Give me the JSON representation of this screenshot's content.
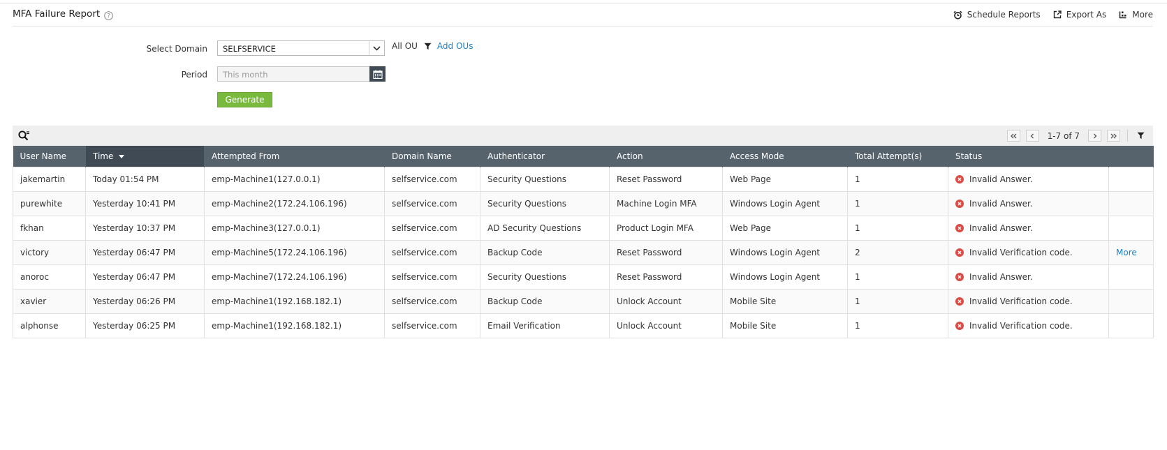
{
  "header": {
    "title": "MFA Failure Report",
    "actions": [
      {
        "label": "Schedule Reports",
        "icon": "alarm-clock-icon"
      },
      {
        "label": "Export As",
        "icon": "export-icon"
      },
      {
        "label": "More",
        "icon": "more-icon"
      }
    ]
  },
  "form": {
    "domain_label": "Select Domain",
    "domain_value": "SELFSERVICE",
    "ou_label": "All OU",
    "add_ous_label": "Add OUs",
    "period_label": "Period",
    "period_placeholder": "This month",
    "generate_label": "Generate"
  },
  "pager": {
    "range_text": "1-7 of 7"
  },
  "table": {
    "columns": [
      "User Name",
      "Time",
      "Attempted From",
      "Domain Name",
      "Authenticator",
      "Action",
      "Access Mode",
      "Total Attempt(s)",
      "Status"
    ],
    "sorted_column": "Time",
    "rows": [
      {
        "user": "jakemartin",
        "time": "Today 01:54 PM",
        "from": "emp-Machine1(127.0.0.1)",
        "domain": "selfservice.com",
        "auth": "Security Questions",
        "action": "Reset Password",
        "mode": "Web Page",
        "attempts": "1",
        "status": "Invalid Answer.",
        "extra": ""
      },
      {
        "user": "purewhite",
        "time": "Yesterday 10:41 PM",
        "from": "emp-Machine2(172.24.106.196)",
        "domain": "selfservice.com",
        "auth": "Security Questions",
        "action": "Machine Login MFA",
        "mode": "Windows Login Agent",
        "attempts": "1",
        "status": "Invalid Answer.",
        "extra": ""
      },
      {
        "user": "fkhan",
        "time": "Yesterday 10:37 PM",
        "from": "emp-Machine3(127.0.0.1)",
        "domain": "selfservice.com",
        "auth": "AD Security Questions",
        "action": "Product Login MFA",
        "mode": "Web Page",
        "attempts": "1",
        "status": "Invalid Answer.",
        "extra": ""
      },
      {
        "user": "victory",
        "time": "Yesterday 06:47 PM",
        "from": "emp-Machine5(172.24.106.196)",
        "domain": "selfservice.com",
        "auth": "Backup Code",
        "action": "Reset Password",
        "mode": "Windows Login Agent",
        "attempts": "2",
        "status": "Invalid Verification code.",
        "extra": "More"
      },
      {
        "user": "anoroc",
        "time": "Yesterday 06:47 PM",
        "from": "emp-Machine7(172.24.106.196)",
        "domain": "selfservice.com",
        "auth": "Security Questions",
        "action": "Reset Password",
        "mode": "Windows Login Agent",
        "attempts": "1",
        "status": "Invalid Answer.",
        "extra": ""
      },
      {
        "user": "xavier",
        "time": "Yesterday 06:26 PM",
        "from": "emp-Machine1(192.168.182.1)",
        "domain": "selfservice.com",
        "auth": "Backup Code",
        "action": "Unlock Account",
        "mode": "Mobile Site",
        "attempts": "1",
        "status": "Invalid Verification code.",
        "extra": ""
      },
      {
        "user": "alphonse",
        "time": "Yesterday 06:25 PM",
        "from": "emp-Machine1(192.168.182.1)",
        "domain": "selfservice.com",
        "auth": "Email Verification",
        "action": "Unlock Account",
        "mode": "Mobile Site",
        "attempts": "1",
        "status": "Invalid Verification code.",
        "extra": ""
      }
    ]
  },
  "colors": {
    "header_bg": "#56626c",
    "sorted_header_bg": "#3f4a55",
    "generate_button": "#79b93d",
    "link": "#1f7ec2",
    "error": "#dc4a44"
  }
}
